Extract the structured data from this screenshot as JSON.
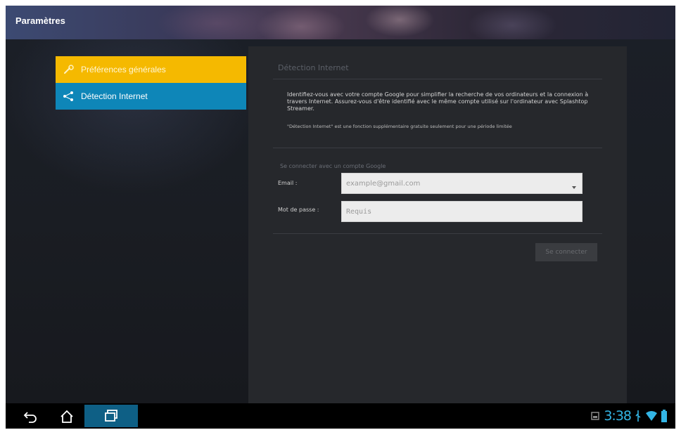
{
  "action_bar": {
    "title": "Paramètres"
  },
  "sidebar": {
    "items": [
      {
        "label": "Préférences générales",
        "icon": "wrench-icon",
        "color": "#f5b900",
        "selected": true
      },
      {
        "label": "Détection Internet",
        "icon": "share-icon",
        "color": "#0e86b8",
        "selected": false
      }
    ]
  },
  "detail": {
    "title": "Détection Internet",
    "description": "Identifiez-vous avec votre compte Google pour simplifier la recherche de vos ordinateurs et la connexion à travers Internet. Assurez-vous d'être identifié avec le même compte utilisé sur l'ordinateur avec Splashtop Streamer.",
    "note": "\"Détection Internet\" est une fonction supplémentaire gratuite seulement pour une période limitée",
    "signin_hint": "Se connecter avec un compte Google",
    "email": {
      "label": "Email :",
      "placeholder": "example@gmail.com"
    },
    "password": {
      "label": "Mot de passe :",
      "placeholder": "Requis"
    },
    "login_button": "Se connecter"
  },
  "system_bar": {
    "clock": "3:38",
    "accent_color": "#33b5e5",
    "nav": [
      "back-icon",
      "home-icon",
      "recent-apps-icon"
    ],
    "status_icons": [
      "notification-icon",
      "usb-icon",
      "wifi-icon",
      "battery-icon"
    ]
  }
}
